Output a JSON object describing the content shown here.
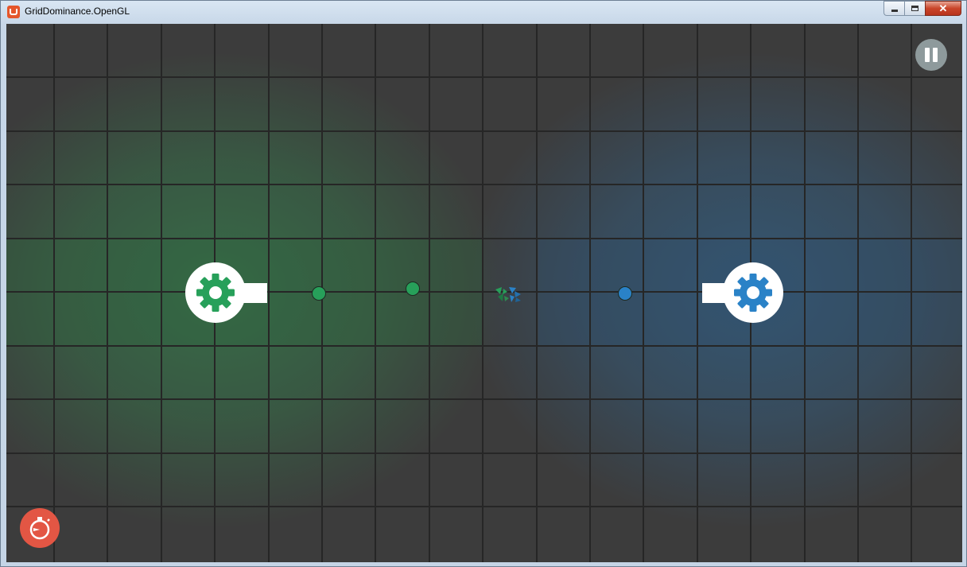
{
  "window": {
    "title": "GridDominance.OpenGL",
    "close_glyph": "✕"
  },
  "game": {
    "grid": {
      "columns": 18,
      "rows": 10
    },
    "colors": {
      "background": "#3c3c3c",
      "grid_line": "#262626",
      "green_team": "#27a05a",
      "blue_team": "#2a82c7",
      "cannon_body": "#ffffff",
      "pause_button": "#8e9a9c",
      "speed_button": "#e35644"
    },
    "cannons": [
      {
        "team": "green",
        "icon": "gear-icon",
        "facing": "right"
      },
      {
        "team": "blue",
        "icon": "gear-icon",
        "facing": "left"
      }
    ],
    "bullets": [
      {
        "team": "green"
      },
      {
        "team": "green"
      },
      {
        "team": "blue"
      }
    ],
    "controls": {
      "pause_icon": "pause-icon",
      "speed_icon": "stopwatch-icon"
    }
  }
}
